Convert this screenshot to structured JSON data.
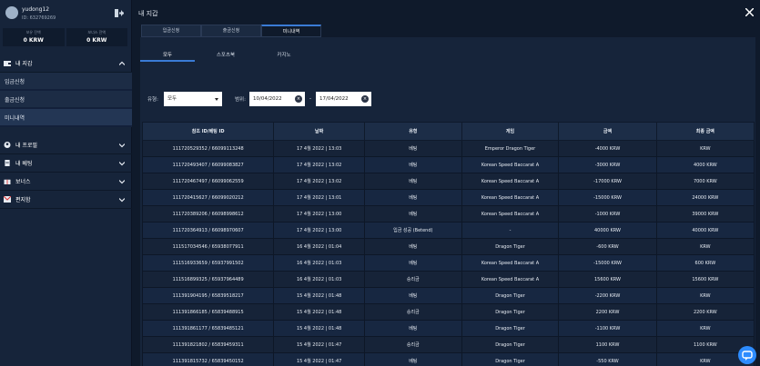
{
  "user": {
    "name": "yudong12",
    "id": "ID: 632769269"
  },
  "balances": [
    {
      "label": "보유 잔액",
      "value": "0 KRW"
    },
    {
      "label": "보너스 잔액",
      "value": "0 KRW"
    }
  ],
  "menu": {
    "wallet": "내 지갑",
    "deposit": "입금신청",
    "withdraw": "출금신청",
    "mini": "미니내역",
    "profile": "내 프로필",
    "bets": "내 베팅",
    "bonus": "보너스",
    "mail": "편지함"
  },
  "page": {
    "title": "내 지갑"
  },
  "top_tabs": [
    "입금신청",
    "출금신청",
    "미니내역"
  ],
  "sub_tabs": [
    "모두",
    "스포츠북",
    "카지노"
  ],
  "filters": {
    "type_label": "유형:",
    "type_value": "모두",
    "range_label": "범위:",
    "from": "10/04/2022",
    "to": "17/04/2022"
  },
  "table": {
    "headers": [
      "참조 ID/베팅 ID",
      "날짜",
      "유형",
      "게임",
      "금액",
      "최종 금액"
    ],
    "rows": [
      [
        "111720529352 / 66099113248",
        "17 4월 2022 | 13:03",
        "베팅",
        "Emperor Dragon Tiger",
        "-4000 KRW",
        "KRW"
      ],
      [
        "111720493407 / 66099083827",
        "17 4월 2022 | 13:02",
        "베팅",
        "Korean Speed Baccarat A",
        "-3000 KRW",
        "4000 KRW"
      ],
      [
        "111720467497 / 66099062559",
        "17 4월 2022 | 13:02",
        "베팅",
        "Korean Speed Baccarat A",
        "-17000 KRW",
        "7000 KRW"
      ],
      [
        "111720415627 / 66099020212",
        "17 4월 2022 | 13:01",
        "베팅",
        "Korean Speed Baccarat A",
        "-15000 KRW",
        "24000 KRW"
      ],
      [
        "111720389206 / 66098998612",
        "17 4월 2022 | 13:00",
        "베팅",
        "Korean Speed Baccarat A",
        "-1000 KRW",
        "39000 KRW"
      ],
      [
        "111720364913 / 66098970607",
        "17 4월 2022 | 13:00",
        "입금 성공 (Betend)",
        "-",
        "40000 KRW",
        "40000 KRW"
      ],
      [
        "111517034546 / 65938077911",
        "16 4월 2022 | 01:04",
        "베팅",
        "Dragon Tiger",
        "-600 KRW",
        "KRW"
      ],
      [
        "111516933659 / 65937991502",
        "16 4월 2022 | 01:03",
        "베팅",
        "Korean Speed Baccarat A",
        "-15000 KRW",
        "600 KRW"
      ],
      [
        "111516899325 / 65937964489",
        "16 4월 2022 | 01:03",
        "승리금",
        "Korean Speed Baccarat A",
        "15600 KRW",
        "15600 KRW"
      ],
      [
        "111391904195 / 65839518217",
        "15 4월 2022 | 01:48",
        "베팅",
        "Dragon Tiger",
        "-2200 KRW",
        "KRW"
      ],
      [
        "111391866185 / 65839488915",
        "15 4월 2022 | 01:48",
        "승리금",
        "Dragon Tiger",
        "2200 KRW",
        "2200 KRW"
      ],
      [
        "111391861177 / 65839485121",
        "15 4월 2022 | 01:48",
        "베팅",
        "Dragon Tiger",
        "-1100 KRW",
        "KRW"
      ],
      [
        "111391821802 / 65839459311",
        "15 4월 2022 | 01:47",
        "승리금",
        "Dragon Tiger",
        "1100 KRW",
        "1100 KRW"
      ],
      [
        "111391815732 / 65839450152",
        "15 4월 2022 | 01:47",
        "베팅",
        "Dragon Tiger",
        "-550 KRW",
        "KRW"
      ]
    ]
  },
  "colors": {
    "accent": "#3a7bd5",
    "sidebar": "#16243a",
    "background": "#0f1a2b",
    "chat": "#2d8cff"
  }
}
